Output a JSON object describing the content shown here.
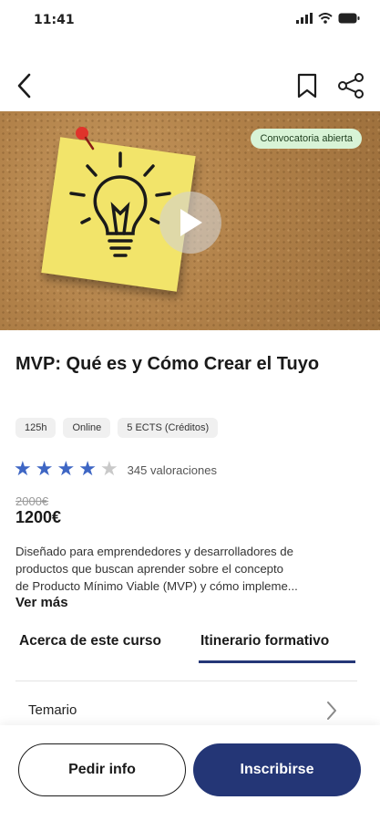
{
  "status_bar": {
    "time": "11:41"
  },
  "hero": {
    "badge": "Convocatoria abierta"
  },
  "course": {
    "title": "MVP: Qué es y Cómo Crear el Tuyo",
    "chips": [
      "125h",
      "Online",
      "5 ECTS (Créditos)"
    ],
    "rating": {
      "stars": 4,
      "max": 5,
      "count_label": "345 valoraciones"
    },
    "old_price": "2000€",
    "price": "1200€",
    "description_lines": [
      "Diseñado para emprendedores y desarrolladores de",
      "productos que buscan aprender sobre el concepto",
      "de Producto Mínimo Viable (MVP) y cómo impleme..."
    ],
    "see_more": "Ver más"
  },
  "tabs": [
    {
      "label": "Acerca de este curso",
      "active": false
    },
    {
      "label": "Itinerario formativo",
      "active": true
    }
  ],
  "syllabus": {
    "label": "Temario"
  },
  "actions": {
    "info_label": "Pedir info",
    "enroll_label": "Inscribirse"
  },
  "colors": {
    "accent": "#243676",
    "star": "#3e66c4",
    "badge_bg": "#d8f3d6"
  },
  "icons": [
    "signal-icon",
    "wifi-icon",
    "battery-icon",
    "back-arrow-icon",
    "bookmark-icon",
    "share-icon",
    "play-icon",
    "chevron-right-icon"
  ]
}
